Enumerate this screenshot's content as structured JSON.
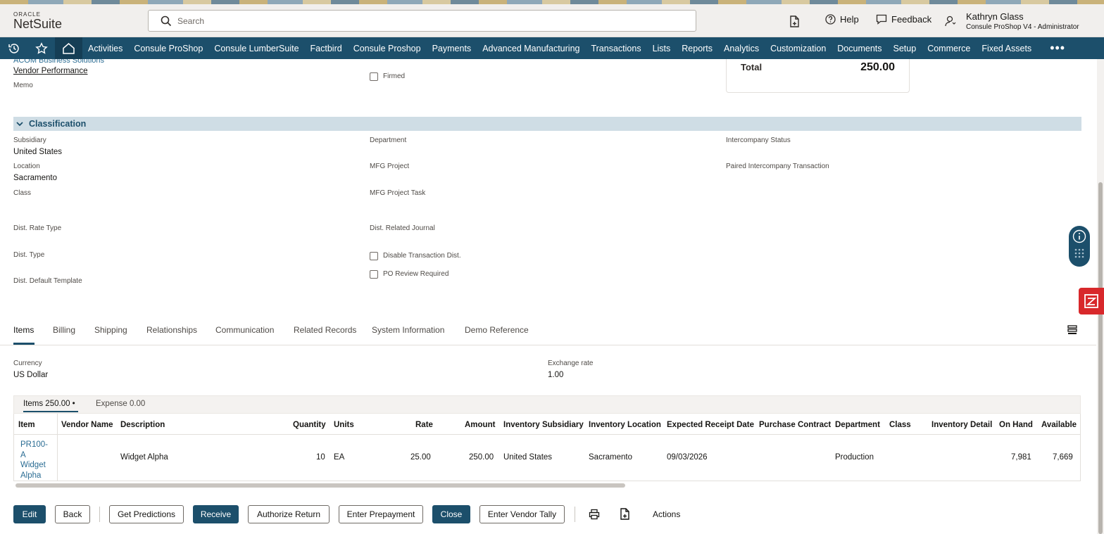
{
  "header": {
    "logo_top": "ORACLE",
    "logo_bottom": "NetSuite",
    "search_placeholder": "Search",
    "help": "Help",
    "feedback": "Feedback",
    "user_name": "Kathryn Glass",
    "user_role": "Consule ProShop V4 - Administrator"
  },
  "nav": {
    "items": [
      "Activities",
      "Consule ProShop",
      "Consule LumberSuite",
      "Factbird",
      "Consule Proshop",
      "Payments",
      "Advanced Manufacturing",
      "Transactions",
      "Lists",
      "Reports",
      "Analytics",
      "Customization",
      "Documents",
      "Setup",
      "Commerce",
      "Fixed Assets"
    ],
    "more": "•••"
  },
  "top_fields": {
    "vendor_link": "ACOM Business Solutions",
    "vendor_performance": "Vendor Performance",
    "memo_label": "Memo",
    "firmed_label": "Firmed",
    "total_label": "Total",
    "total_value": "250.00"
  },
  "classification": {
    "title": "Classification",
    "subsidiary_label": "Subsidiary",
    "subsidiary_value": "United States",
    "location_label": "Location",
    "location_value": "Sacramento",
    "class_label": "Class",
    "department_label": "Department",
    "mfg_project_label": "MFG Project",
    "mfg_project_task_label": "MFG Project Task",
    "intercompany_status_label": "Intercompany Status",
    "paired_intercompany_label": "Paired Intercompany Transaction",
    "dist_rate_type_label": "Dist. Rate Type",
    "dist_related_journal_label": "Dist. Related Journal",
    "dist_type_label": "Dist. Type",
    "disable_dist_label": "Disable Transaction Dist.",
    "po_review_label": "PO Review Required",
    "dist_default_template_label": "Dist. Default Template"
  },
  "tabs": [
    "Items",
    "Billing",
    "Shipping",
    "Relationships",
    "Communication",
    "Related Records",
    "System Information",
    "Demo Reference"
  ],
  "currency": {
    "currency_label": "Currency",
    "currency_value": "US Dollar",
    "exchange_label": "Exchange rate",
    "exchange_value": "1.00"
  },
  "subtabs": {
    "items": "Items 250.00 •",
    "expense": "Expense 0.00"
  },
  "grid": {
    "headers": [
      "Item",
      "Vendor Name",
      "Description",
      "Quantity",
      "Units",
      "Rate",
      "Amount",
      "Inventory Subsidiary",
      "Inventory Location",
      "Expected Receipt Date",
      "Purchase Contract",
      "Department",
      "Class",
      "Inventory Detail",
      "On Hand",
      "Available"
    ],
    "row": {
      "item": "PR100-A Widget Alpha",
      "vendor_name": "",
      "description": "Widget Alpha",
      "quantity": "10",
      "units": "EA",
      "rate": "25.00",
      "amount": "250.00",
      "inventory_subsidiary": "United States",
      "inventory_location": "Sacramento",
      "expected_receipt_date": "09/03/2026",
      "purchase_contract": "",
      "department": "Production",
      "class": "",
      "inventory_detail": "",
      "on_hand": "7,981",
      "available": "7,669"
    }
  },
  "buttons": {
    "edit": "Edit",
    "back": "Back",
    "get_predictions": "Get Predictions",
    "receive": "Receive",
    "authorize_return": "Authorize Return",
    "enter_prepayment": "Enter Prepayment",
    "close": "Close",
    "enter_vendor_tally": "Enter Vendor Tally",
    "actions": "Actions"
  },
  "colors": {
    "nav_bg": "#1c4f6b",
    "section_bg": "#cfdde5",
    "link": "#2a6c93",
    "primary_button": "#1c4f6b"
  }
}
